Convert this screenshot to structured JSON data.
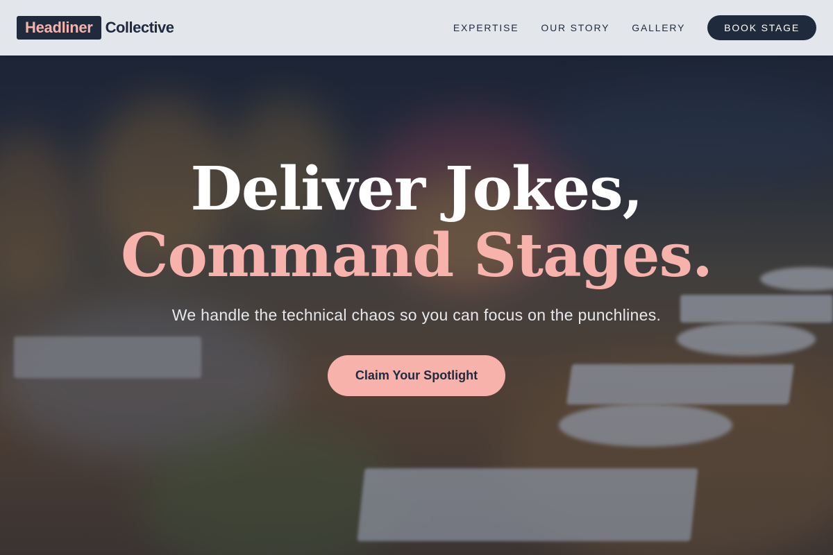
{
  "header": {
    "logo_box": "Headliner",
    "logo_text": "Collective",
    "nav": [
      {
        "label": "EXPERTISE"
      },
      {
        "label": "OUR STORY"
      },
      {
        "label": "GALLERY"
      }
    ],
    "cta_label": "BOOK STAGE"
  },
  "hero": {
    "title_line1": "Deliver Jokes,",
    "title_line2": "Command Stages.",
    "subtitle": "We handle the technical chaos so you can focus on the punchlines.",
    "button_label": "Claim Your Spotlight",
    "background_image": "blurred banquet table with flowers, glasses and plates"
  },
  "colors": {
    "navy": "#1f2a3d",
    "accent_pink": "#f7b2ac",
    "header_bg": "#ebeef2"
  }
}
